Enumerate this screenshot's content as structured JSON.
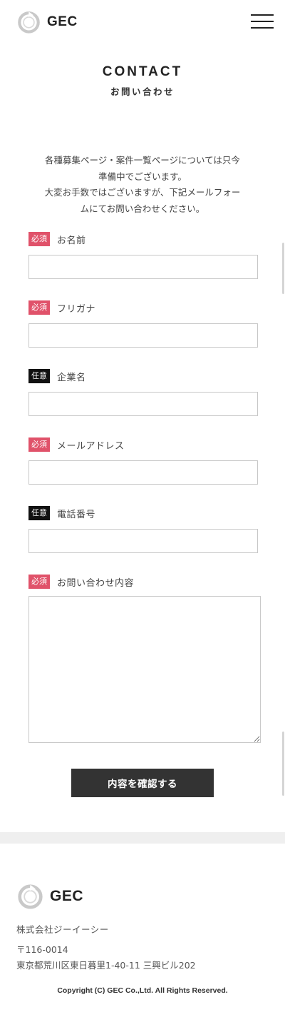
{
  "header": {
    "logo_text": "GEC",
    "menu_icon": "hamburger-icon"
  },
  "title": {
    "en": "CONTACT",
    "ja": "お問い合わせ"
  },
  "intro": {
    "line1": "各種募集ページ・案件一覧ページについては只今",
    "line2": "準備中でございます。",
    "line3": "大変お手数ではございますが、下記メールフォー",
    "line4": "ムにてお問い合わせください。"
  },
  "form": {
    "fields": [
      {
        "badge": "必須",
        "required": true,
        "label": "お名前",
        "value": ""
      },
      {
        "badge": "必須",
        "required": true,
        "label": "フリガナ",
        "value": ""
      },
      {
        "badge": "任意",
        "required": false,
        "label": "企業名",
        "value": ""
      },
      {
        "badge": "必須",
        "required": true,
        "label": "メールアドレス",
        "value": ""
      },
      {
        "badge": "任意",
        "required": false,
        "label": "電話番号",
        "value": ""
      },
      {
        "badge": "必須",
        "required": true,
        "label": "お問い合わせ内容",
        "value": ""
      }
    ],
    "submit_label": "内容を確認する"
  },
  "footer": {
    "logo_text": "GEC",
    "company": "株式会社ジーイーシー",
    "postal": "〒116-0014",
    "address": "東京都荒川区東日暮里1-40-11 三興ビル202",
    "copyright": "Copyright (C) GEC Co.,Ltd. All Rights Reserved."
  },
  "colors": {
    "required_badge": "#e0526a",
    "optional_badge": "#111111",
    "button": "#333333",
    "divider": "#efefef"
  }
}
